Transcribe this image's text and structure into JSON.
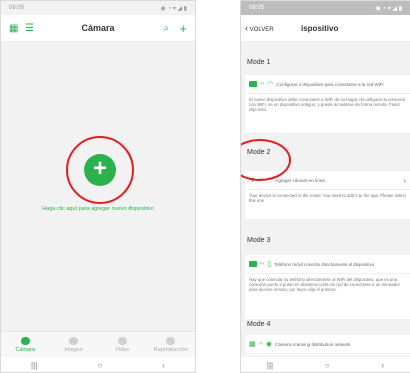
{
  "left": {
    "status_time": "08:05",
    "status_icons": "◉ ◔ ▾ ◢ ▮",
    "title": "Cámara",
    "hint": "Haga clic aquí para agregar nuevo dispositivo",
    "nav": [
      {
        "label": "Cámara",
        "active": true
      },
      {
        "label": "Imagen",
        "active": false
      },
      {
        "label": "Vídeo",
        "active": false
      },
      {
        "label": "Reproducción",
        "active": false
      }
    ],
    "sys": [
      "|||",
      "○",
      "‹"
    ]
  },
  "right": {
    "status_time": "08:05",
    "status_icons": "◉ ◔ ▾ ◢ ▮",
    "back_label": "VOLVER",
    "title": "ispositivo",
    "modes": [
      {
        "header": "Mode 1",
        "row": "Configurar o dispositivo para conectarse a la red WiFi",
        "text": "El nuevo dispositivo debe conectarse a WiFi de su hogar, reconfigurar la conexión con WiFi, se un dispositivo antiguo, y puede accederse de forma remota. Favor elija esto."
      },
      {
        "header": "Mode 2",
        "row": "Agregar cámara en línea",
        "text": "Your device is connected to the router. You need to add it to the app. Please select this one"
      },
      {
        "header": "Mode 3",
        "row": "Teléfono móvil conecta directamente al dispositivo",
        "text": "Hay que conectar su teléfono directamente al WiFi del dispositivo, que es una conexión punto a punto en distancia corta sin red de conectarse a un enrutador para acceso remoto, por favor elija el primero."
      },
      {
        "header": "Mode 4",
        "row": "Camera scanning distribution network",
        "text": ""
      }
    ],
    "sys": [
      "|||",
      "○",
      "‹"
    ]
  },
  "colors": {
    "accent": "#2bb24c",
    "annotation": "#e02020"
  }
}
